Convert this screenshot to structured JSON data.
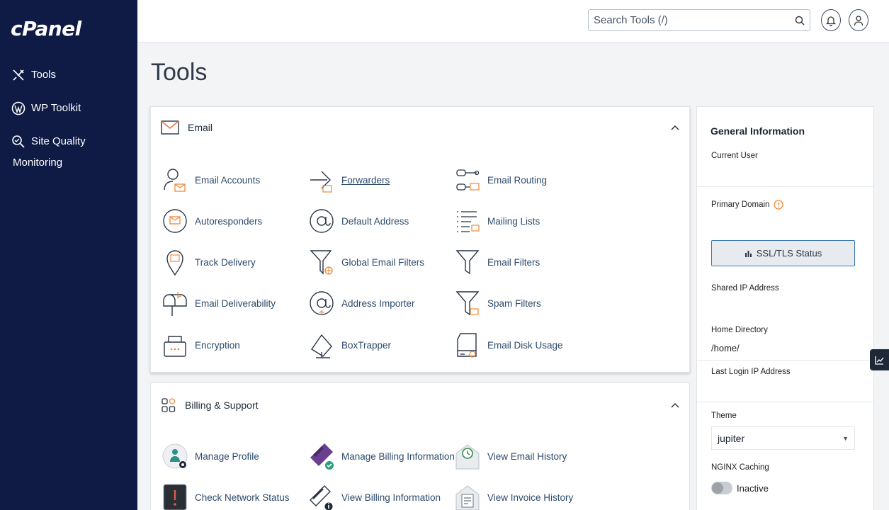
{
  "sidebar": {
    "logo": "cPanel",
    "items": [
      {
        "label": "Tools",
        "icon": "tools-icon"
      },
      {
        "label": "WP Toolkit",
        "icon": "wordpress-icon"
      },
      {
        "label": "Site Quality Monitoring",
        "icon": "site-quality-icon"
      }
    ]
  },
  "header": {
    "search_placeholder": "Search Tools (/)",
    "icons": [
      "search-icon",
      "bell-icon",
      "user-icon"
    ]
  },
  "page_title": "Tools",
  "email_section": {
    "title": "Email",
    "tools": [
      {
        "label": "Email Accounts",
        "icon": "email-accounts-icon"
      },
      {
        "label": "Forwarders",
        "icon": "forwarders-icon"
      },
      {
        "label": "Email Routing",
        "icon": "email-routing-icon"
      },
      {
        "label": "Autoresponders",
        "icon": "autoresponders-icon"
      },
      {
        "label": "Default Address",
        "icon": "default-address-icon"
      },
      {
        "label": "Mailing Lists",
        "icon": "mailing-lists-icon"
      },
      {
        "label": "Track Delivery",
        "icon": "track-delivery-icon"
      },
      {
        "label": "Global Email Filters",
        "icon": "global-filters-icon"
      },
      {
        "label": "Email Filters",
        "icon": "email-filters-icon"
      },
      {
        "label": "Email Deliverability",
        "icon": "deliverability-icon"
      },
      {
        "label": "Address Importer",
        "icon": "address-importer-icon"
      },
      {
        "label": "Spam Filters",
        "icon": "spam-filters-icon"
      },
      {
        "label": "Encryption",
        "icon": "encryption-icon"
      },
      {
        "label": "BoxTrapper",
        "icon": "boxtrapper-icon"
      },
      {
        "label": "Email Disk Usage",
        "icon": "disk-usage-icon"
      }
    ]
  },
  "billing_section": {
    "title": "Billing & Support",
    "tools": [
      {
        "label": "Manage Profile",
        "icon": "manage-profile-icon"
      },
      {
        "label": "Manage Billing Information",
        "icon": "billing-card-icon"
      },
      {
        "label": "View Email History",
        "icon": "email-history-icon"
      },
      {
        "label": "Check Network Status",
        "icon": "network-status-icon"
      },
      {
        "label": "View Billing Information",
        "icon": "billing-info-icon"
      },
      {
        "label": "View Invoice History",
        "icon": "invoice-history-icon"
      }
    ]
  },
  "general_info": {
    "title": "General Information",
    "current_user_label": "Current User",
    "primary_domain_label": "Primary Domain",
    "ssl_button": "SSL/TLS Status",
    "shared_ip_label": "Shared IP Address",
    "home_dir_label": "Home Directory",
    "home_dir_value": "/home/",
    "last_login_label": "Last Login IP Address",
    "theme_label": "Theme",
    "theme_value": "jupiter",
    "nginx_label": "NGINX Caching",
    "nginx_status": "Inactive"
  },
  "colors": {
    "sidebar_bg": "#0f1b45",
    "accent_orange": "#f0893a",
    "link_blue": "#2d4a6b",
    "icon_stroke": "#2a3546"
  }
}
